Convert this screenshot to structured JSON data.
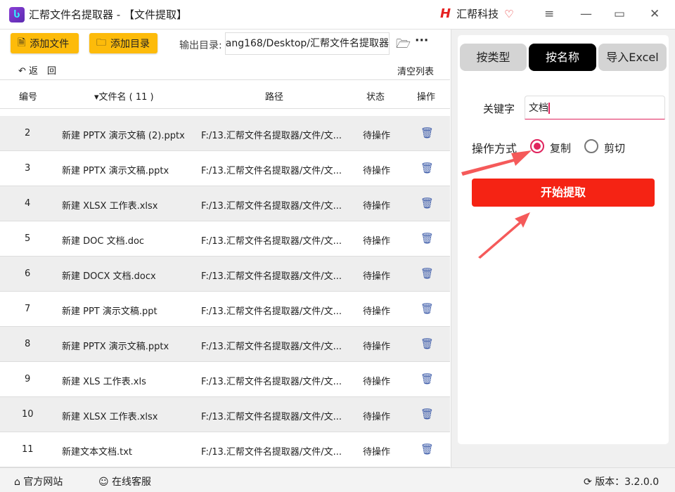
{
  "window": {
    "title": "汇帮文件名提取器 - 【文件提取】",
    "brand": "汇帮科技"
  },
  "toolbar": {
    "add_file": "添加文件",
    "add_folder": "添加目录",
    "output_label": "输出目录:",
    "output_path": "ang168/Desktop/汇帮文件名提取器",
    "back": "返　回",
    "clear": "清空列表"
  },
  "table": {
    "headers": {
      "num": "编号",
      "name": "▾文件名 ( 11 )",
      "path": "路径",
      "status": "状态",
      "action": "操作"
    },
    "rows": [
      {
        "num": "2",
        "name": "新建 PPTX 演示文稿 (2).pptx",
        "path": "F:/13.汇帮文件名提取器/文件/文...",
        "status": "待操作"
      },
      {
        "num": "3",
        "name": "新建 PPTX 演示文稿.pptx",
        "path": "F:/13.汇帮文件名提取器/文件/文...",
        "status": "待操作"
      },
      {
        "num": "4",
        "name": "新建 XLSX 工作表.xlsx",
        "path": "F:/13.汇帮文件名提取器/文件/文...",
        "status": "待操作"
      },
      {
        "num": "5",
        "name": "新建 DOC 文档.doc",
        "path": "F:/13.汇帮文件名提取器/文件/文...",
        "status": "待操作"
      },
      {
        "num": "6",
        "name": "新建 DOCX 文档.docx",
        "path": "F:/13.汇帮文件名提取器/文件/文...",
        "status": "待操作"
      },
      {
        "num": "7",
        "name": "新建 PPT 演示文稿.ppt",
        "path": "F:/13.汇帮文件名提取器/文件/文...",
        "status": "待操作"
      },
      {
        "num": "8",
        "name": "新建 PPTX 演示文稿.pptx",
        "path": "F:/13.汇帮文件名提取器/文件/文...",
        "status": "待操作"
      },
      {
        "num": "9",
        "name": "新建 XLS 工作表.xls",
        "path": "F:/13.汇帮文件名提取器/文件/文...",
        "status": "待操作"
      },
      {
        "num": "10",
        "name": "新建 XLSX 工作表.xlsx",
        "path": "F:/13.汇帮文件名提取器/文件/文...",
        "status": "待操作"
      },
      {
        "num": "11",
        "name": "新建文本文档.txt",
        "path": "F:/13.汇帮文件名提取器/文件/文...",
        "status": "待操作"
      }
    ]
  },
  "panel": {
    "tabs": [
      "按类型",
      "按名称",
      "导入Excel"
    ],
    "active_tab": "按名称",
    "keyword_label": "关键字",
    "keyword_value": "文档",
    "op_label": "操作方式",
    "op_copy": "复制",
    "op_cut": "剪切",
    "op_selected": "复制",
    "start": "开始提取"
  },
  "footer": {
    "website": "官方网站",
    "support": "在线客服",
    "version": "版本：3.2.0.0"
  },
  "colors": {
    "accent": "#fdbb0a",
    "start": "#f52314",
    "radio": "#e0245e"
  }
}
